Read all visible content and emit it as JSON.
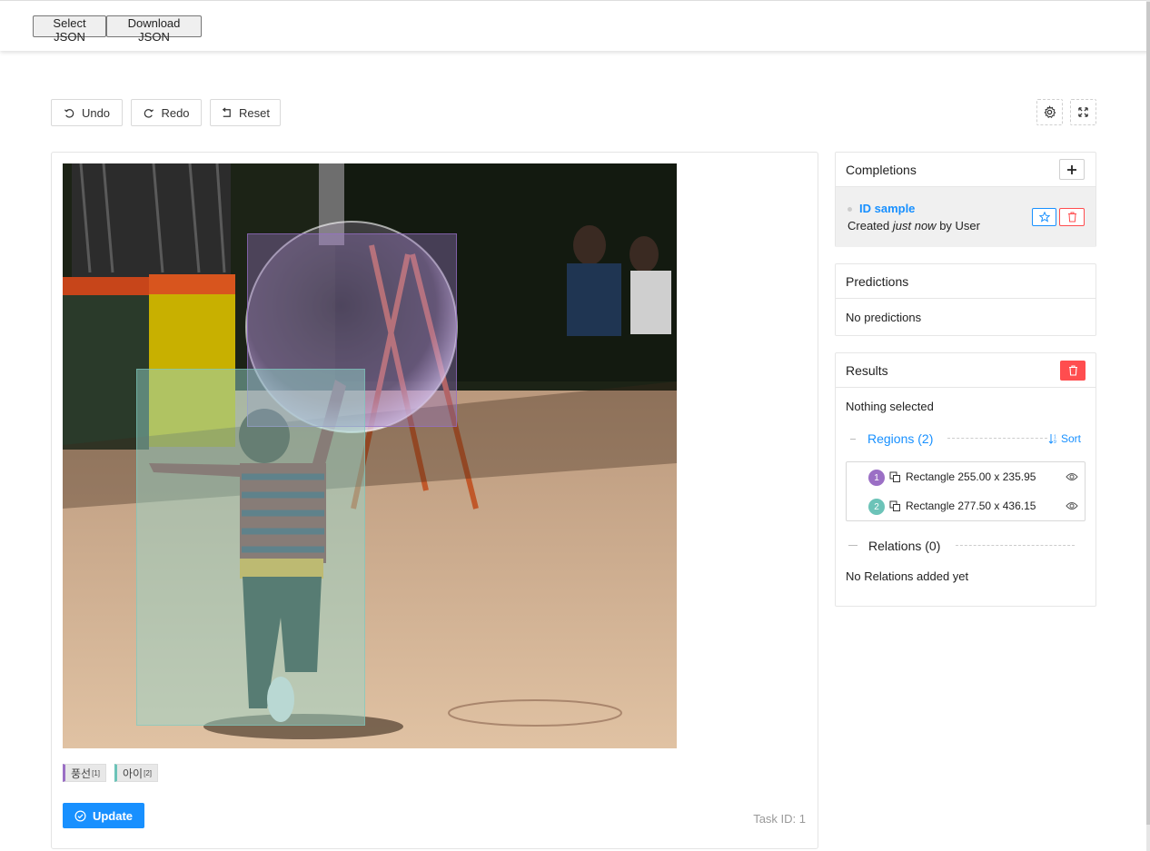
{
  "topbar": {
    "select_json": "Select JSON",
    "download_json": "Download JSON"
  },
  "toolbar": {
    "undo": "Undo",
    "redo": "Redo",
    "reset": "Reset"
  },
  "labels": [
    {
      "name": "풍선",
      "index": "[1]",
      "color": "#9b6fc5"
    },
    {
      "name": "아이",
      "index": "[2]",
      "color": "#6cc3b8"
    }
  ],
  "update_label": "Update",
  "task_id": "Task ID: 1",
  "completions": {
    "title": "Completions",
    "item": {
      "id": "ID sample",
      "created_prefix": "Created ",
      "created_when": "just now",
      "created_suffix": " by User"
    }
  },
  "predictions": {
    "title": "Predictions",
    "empty": "No predictions"
  },
  "results": {
    "title": "Results",
    "nothing_selected": "Nothing selected",
    "regions_title": "Regions (2)",
    "sort_label": "Sort",
    "regions": [
      {
        "num": "1",
        "label": "Rectangle 255.00 x 235.95",
        "color": "#9b6fc5"
      },
      {
        "num": "2",
        "label": "Rectangle 277.50 x 436.15",
        "color": "#6cc3b8"
      }
    ],
    "relations_title": "Relations (0)",
    "relations_empty": "No Relations added yet"
  },
  "colors": {
    "accent": "#1890ff",
    "danger": "#ff4d4f"
  }
}
